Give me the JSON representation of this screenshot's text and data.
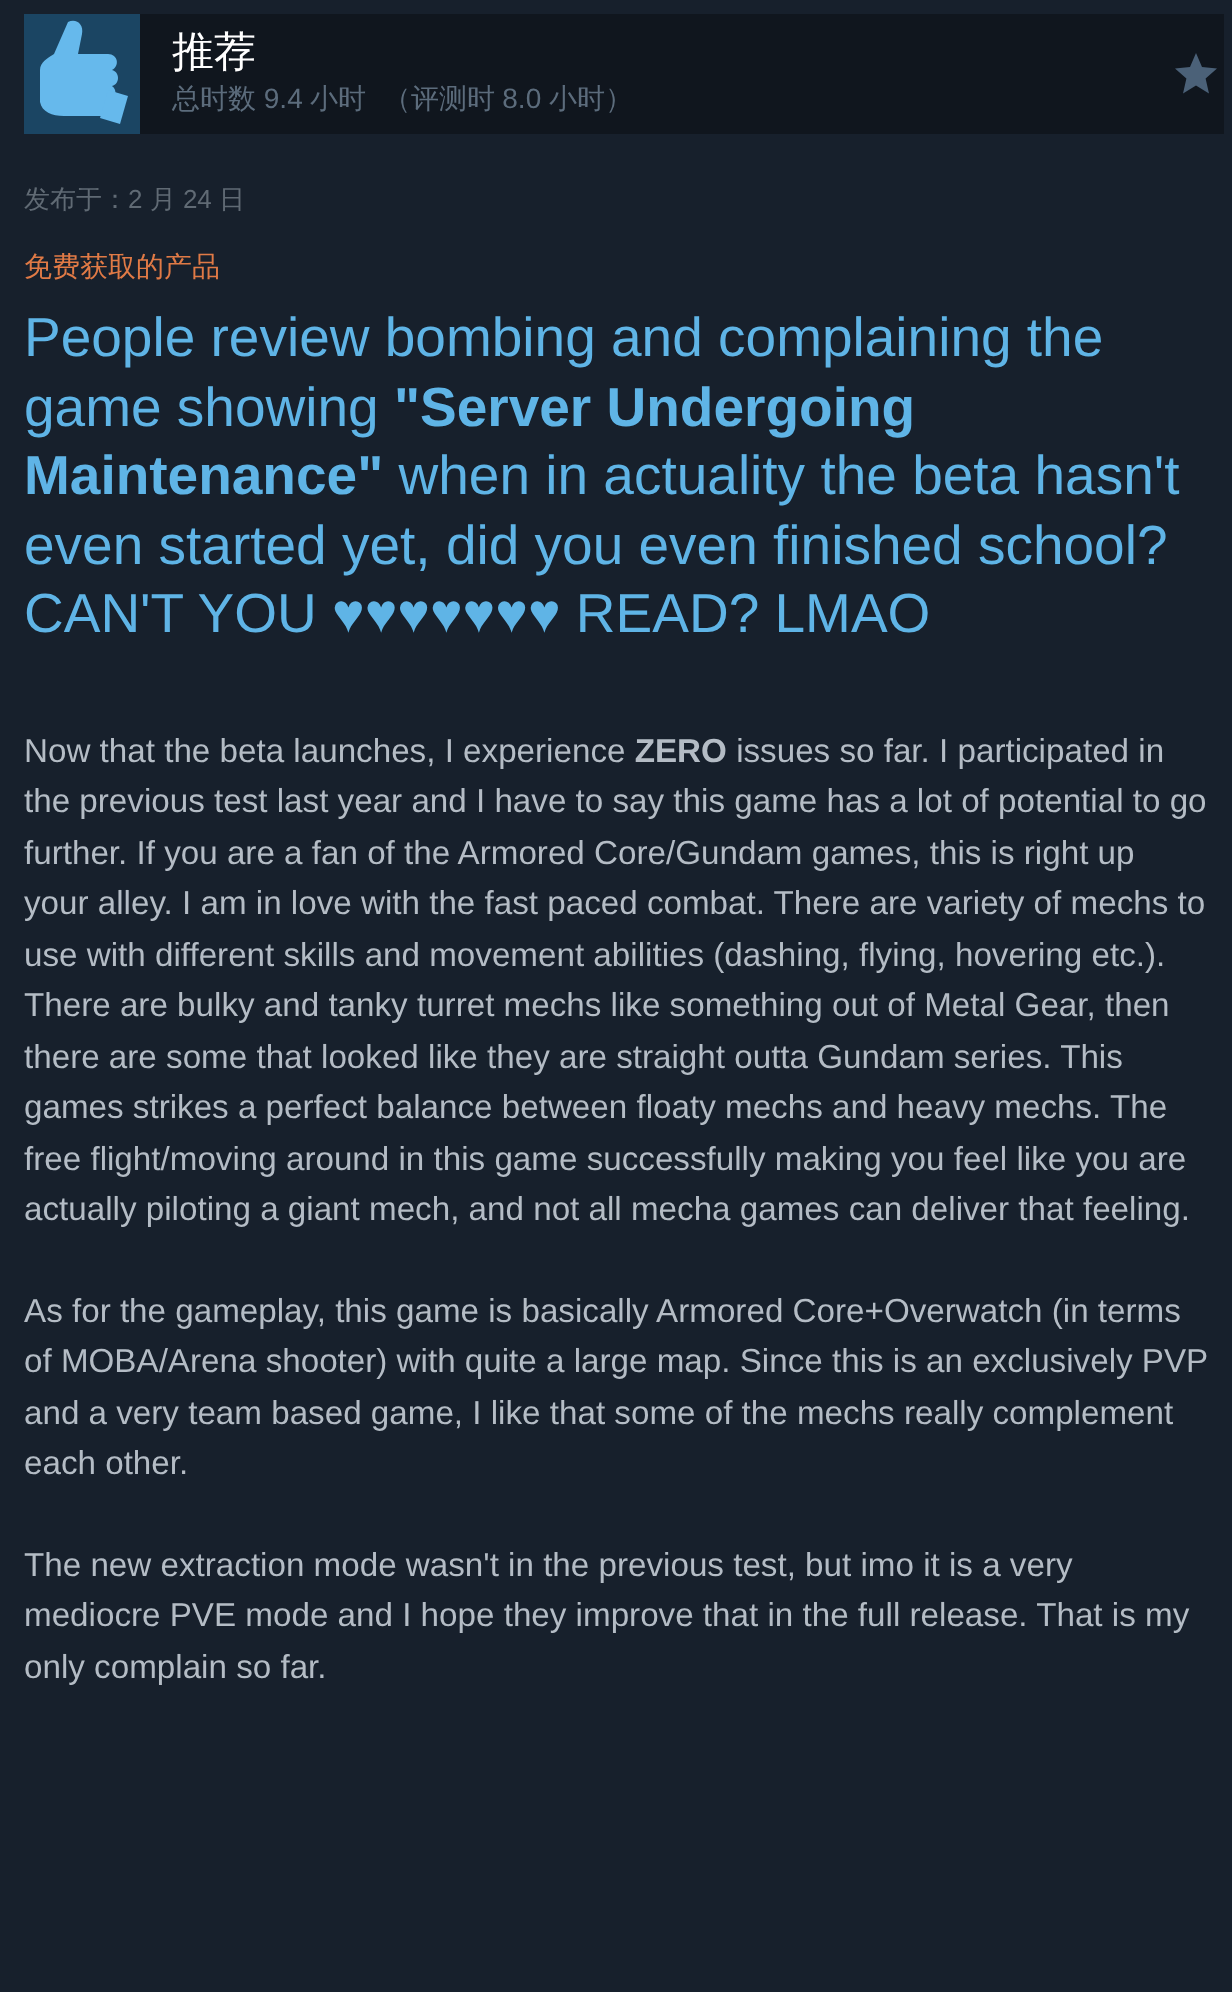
{
  "review": {
    "verdict": "推荐",
    "hours": "总时数 9.4 小时",
    "hours_at_review": "（评测时 8.0 小时）",
    "posted": "发布于：2 月 24 日",
    "free_notice": "免费获取的产品",
    "headline": "People review bombing and complaining the game showing **\"Server Undergoing Maintenance\"** when in actuality the beta hasn't even started yet, did you even finished school? CAN'T YOU ♥♥♥♥♥♥♥ READ? LMAO",
    "paragraphs": [
      "Now that the beta launches, I experience **ZERO** issues so far. I participated in the previous test last year and I have to say this game has a lot of potential to go further. If you are a fan of the Armored Core/Gundam games, this is right up your alley. I am in love with the fast paced combat. There are variety of mechs to use with different skills and movement abilities (dashing, flying, hovering etc.). There are bulky and tanky turret mechs like something out of Metal Gear, then there are some that looked like they are straight outta Gundam series. This games strikes a perfect balance between floaty mechs and heavy mechs. The free flight/moving around in this game successfully making you feel like you are actually piloting a giant mech, and not all mecha games can deliver that feeling.",
      "As for the gameplay, this game is basically Armored Core+Overwatch (in terms of MOBA/Arena shooter) with quite a large map. Since this is an exclusively PVP and a very team based game, I like that some of the mechs really complement each other.",
      "The new extraction mode wasn't in the previous test, but imo it is a very mediocre PVE mode and I hope they improve that in the full release. That is my only complain so far."
    ]
  }
}
